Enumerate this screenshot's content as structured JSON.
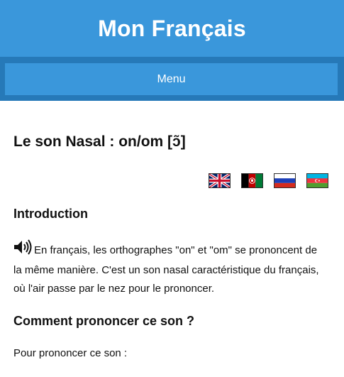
{
  "header": {
    "site_title": "Mon Français",
    "color": "#3a97db"
  },
  "nav": {
    "menu_label": "Menu",
    "strip_color": "#2679b8"
  },
  "article": {
    "title": "Le son Nasal : on/om [ɔ̃]",
    "languages": [
      {
        "name": "English",
        "icon": "uk-flag-icon"
      },
      {
        "name": "Dari/Pashto",
        "icon": "afghanistan-flag-icon"
      },
      {
        "name": "Russian",
        "icon": "russia-flag-icon"
      },
      {
        "name": "Azerbaijani",
        "icon": "azerbaijan-flag-icon"
      }
    ],
    "intro_heading": "Introduction",
    "audio_icon": "speaker-icon",
    "intro_text": "En français, les orthographes \"on\" et \"om\" se prononcent de la même manière. C'est un son nasal caractéristique du français, où l'air passe par le nez pour le prononcer.",
    "how_heading": "Comment prononcer ce son ?",
    "how_text": "Pour prononcer ce son :"
  }
}
